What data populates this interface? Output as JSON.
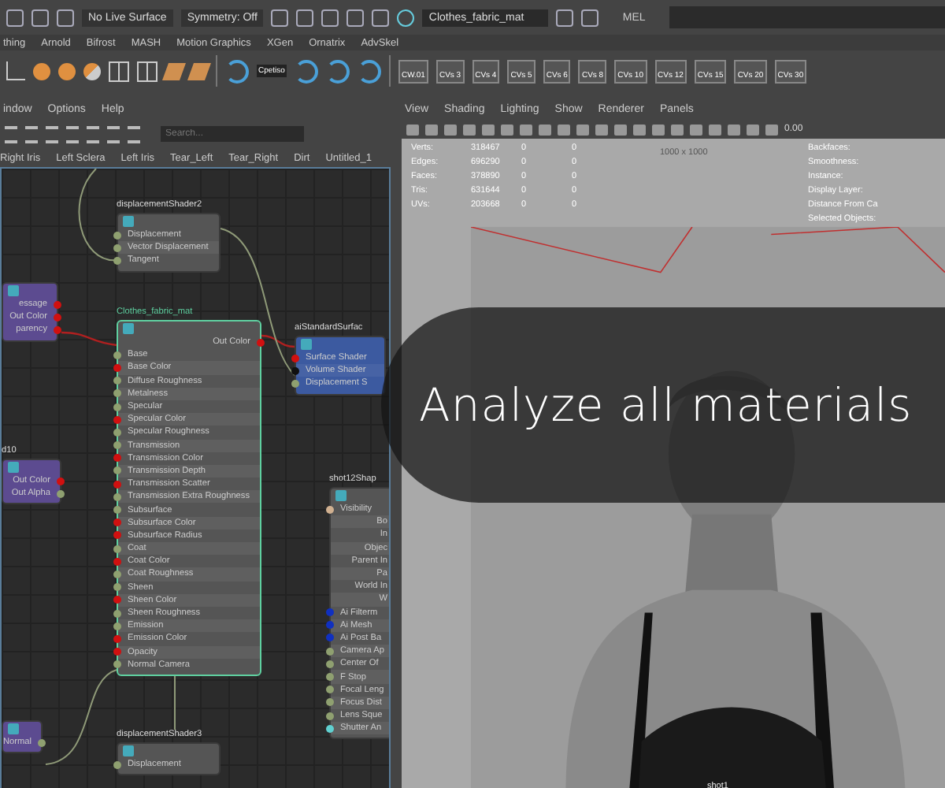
{
  "status_line": {
    "live_surface": "No Live Surface",
    "symmetry": "Symmetry: Off",
    "material_field": "Clothes_fabric_mat",
    "command_label": "MEL"
  },
  "shelf_tabs": [
    "thing",
    "Arnold",
    "Bifrost",
    "MASH",
    "Motion Graphics",
    "XGen",
    "Ornatrix",
    "AdvSkel"
  ],
  "shelf_icon_caption": "Cpetiso",
  "shelf_buttons": [
    "CW.01",
    "CVs 3",
    "CVs 4",
    "CVs 5",
    "CVs 6",
    "CVs 8",
    "CVs 10",
    "CVs 12",
    "CVs 15",
    "CVs 20",
    "CVs 30"
  ],
  "node_editor": {
    "menus": [
      "indow",
      "Options",
      "Help"
    ],
    "search": {
      "placeholder": "Search..."
    },
    "tabs": [
      "Right Iris",
      "Left Sclera",
      "Left Iris",
      "Tear_Left",
      "Tear_Right",
      "Dirt",
      "Untitled_1"
    ],
    "nodes": [
      {
        "kind": "utility",
        "title": "displacementShader2",
        "attributes": [
          {
            "label": "Displacement",
            "color": "#8fa070"
          },
          {
            "label": "Vector Displacement",
            "color": "#8fa070"
          },
          {
            "label": "Tangent",
            "color": "#8fa070"
          }
        ]
      },
      {
        "kind": "texture",
        "out": [
          {
            "label": "essage",
            "color": "#d01010"
          },
          {
            "label": "Out Color",
            "color": "#d01010"
          },
          {
            "label": "parency",
            "color": "#d01010"
          }
        ]
      },
      {
        "kind": "material",
        "title": "Clothes_fabric_mat",
        "out": [
          {
            "label": "Out Color",
            "color": "#d01010"
          }
        ],
        "attributes": [
          {
            "label": "Base",
            "color": "#8fa070"
          },
          {
            "label": "Base Color",
            "color": "#d01010"
          },
          {
            "label": "Diffuse Roughness",
            "color": "#8fa070"
          },
          {
            "label": "Metalness",
            "color": "#8fa070"
          },
          {
            "label": "Specular",
            "color": "#8fa070"
          },
          {
            "label": "Specular Color",
            "color": "#d01010"
          },
          {
            "label": "Specular Roughness",
            "color": "#8fa070"
          },
          {
            "label": "Transmission",
            "color": "#8fa070"
          },
          {
            "label": "Transmission Color",
            "color": "#d01010"
          },
          {
            "label": "Transmission Depth",
            "color": "#8fa070"
          },
          {
            "label": "Transmission Scatter",
            "color": "#d01010"
          },
          {
            "label": "Transmission Extra Roughness",
            "color": "#8fa070"
          },
          {
            "label": "Subsurface",
            "color": "#8fa070"
          },
          {
            "label": "Subsurface Color",
            "color": "#d01010"
          },
          {
            "label": "Subsurface Radius",
            "color": "#d01010"
          },
          {
            "label": "Coat",
            "color": "#8fa070"
          },
          {
            "label": "Coat Color",
            "color": "#d01010"
          },
          {
            "label": "Coat Roughness",
            "color": "#8fa070"
          },
          {
            "label": "Sheen",
            "color": "#8fa070"
          },
          {
            "label": "Sheen Color",
            "color": "#d01010"
          },
          {
            "label": "Sheen Roughness",
            "color": "#8fa070"
          },
          {
            "label": "Emission",
            "color": "#8fa070"
          },
          {
            "label": "Emission Color",
            "color": "#d01010"
          },
          {
            "label": "Opacity",
            "color": "#d01010"
          },
          {
            "label": "Normal Camera",
            "color": "#8fa070"
          }
        ]
      },
      {
        "kind": "shader",
        "title": "aiStandardSurfac",
        "attributes": [
          {
            "label": "Surface Shader",
            "color": "#d01010"
          },
          {
            "label": "Volume Shader",
            "color": "#101010"
          },
          {
            "label": "Displacement S",
            "color": "#8fa070"
          }
        ]
      },
      {
        "kind": "texture",
        "title": "d10",
        "out": [
          {
            "label": "Out Color",
            "color": "#d01010"
          },
          {
            "label": "Out Alpha",
            "color": "#8fa070"
          }
        ]
      },
      {
        "kind": "shape",
        "title": "shot12Shap",
        "attributes": [
          {
            "label": "Visibility",
            "color": "#d0b090"
          },
          {
            "label": "Bo"
          },
          {
            "label": "In"
          },
          {
            "label": "Objec"
          },
          {
            "label": "Parent In"
          },
          {
            "label": "Pa"
          },
          {
            "label": "World In"
          },
          {
            "label": "W"
          },
          {
            "label": "Ai Filterm",
            "color": "#1030c0"
          },
          {
            "label": "Ai Mesh",
            "color": "#1030c0"
          },
          {
            "label": "Ai Post Ba",
            "color": "#1030c0"
          },
          {
            "label": "Camera Ap",
            "color": "#8fa070"
          },
          {
            "label": "Center Of",
            "color": "#8fa070"
          },
          {
            "label": "F Stop",
            "color": "#8fa070"
          },
          {
            "label": "Focal Leng",
            "color": "#8fa070"
          },
          {
            "label": "Focus Dist",
            "color": "#8fa070"
          },
          {
            "label": "Lens Sque",
            "color": "#8fa070"
          },
          {
            "label": "Shutter An",
            "color": "#60d0d0"
          }
        ]
      },
      {
        "kind": "texture",
        "out": [
          {
            "label": "Normal",
            "color": "#8fa070"
          }
        ]
      },
      {
        "kind": "utility",
        "title": "displacementShader3",
        "attributes": [
          {
            "label": "Displacement",
            "color": "#8fa070"
          }
        ]
      }
    ]
  },
  "viewport": {
    "menus": [
      "View",
      "Shading",
      "Lighting",
      "Show",
      "Renderer",
      "Panels"
    ],
    "field_value": "0.00",
    "stats": [
      {
        "label": "Verts:",
        "values": [
          "318467",
          "0",
          "0"
        ]
      },
      {
        "label": "Edges:",
        "values": [
          "696290",
          "0",
          "0"
        ]
      },
      {
        "label": "Faces:",
        "values": [
          "378890",
          "0",
          "0"
        ]
      },
      {
        "label": "Tris:",
        "values": [
          "631644",
          "0",
          "0"
        ]
      },
      {
        "label": "UVs:",
        "values": [
          "203668",
          "0",
          "0"
        ]
      }
    ],
    "resolution": "1000 x 1000",
    "hud_right": [
      "Backfaces:",
      "Smoothness:",
      "Instance:",
      "Display Layer:",
      "Distance From Ca",
      "Selected Objects:"
    ],
    "camera_label": "shot1"
  },
  "overlay_text": "Analyze all materials"
}
